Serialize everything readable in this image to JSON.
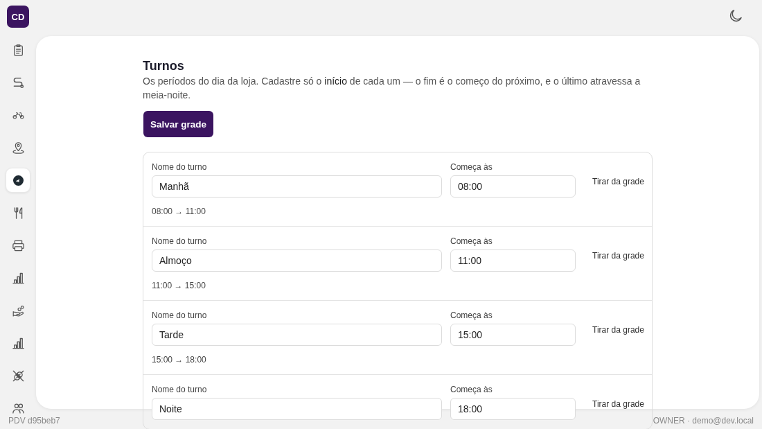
{
  "brand": {
    "initials": "CD"
  },
  "sidebar": {
    "items": [
      {
        "selected": false
      },
      {
        "selected": false
      },
      {
        "selected": false
      },
      {
        "selected": false
      },
      {
        "selected": true
      },
      {
        "selected": false
      },
      {
        "selected": false
      },
      {
        "selected": false
      },
      {
        "selected": false
      },
      {
        "selected": false
      },
      {
        "selected": false
      },
      {
        "selected": false
      }
    ]
  },
  "page": {
    "title": "Turnos",
    "description": "Os períodos do dia da loja. Cadastre só o **início** de cada um — o fim é o começo do próximo, e o último atravessa a meia-noite.",
    "save_button": "Salvar grade"
  },
  "shifts": [
    {
      "name_label": "Nome do turno",
      "name": "Manhã",
      "start_label": "Começa às",
      "start": "08:00",
      "remove_button": "Tirar da grade",
      "range": "08:00 → 11:00"
    },
    {
      "name_label": "Nome do turno",
      "name": "Almoço",
      "start_label": "Começa às",
      "start": "11:00",
      "remove_button": "Tirar da grade",
      "range": "11:00 → 15:00"
    },
    {
      "name_label": "Nome do turno",
      "name": "Tarde",
      "start_label": "Começa às",
      "start": "15:00",
      "remove_button": "Tirar da grade",
      "range": "15:00 → 18:00"
    },
    {
      "name_label": "Nome do turno",
      "name": "Noite",
      "start_label": "Começa às",
      "start": "18:00",
      "remove_button": "Tirar da grade"
    }
  ],
  "footer": {
    "build": "PDV d95beb7",
    "user": "OWNER · demo@dev.local"
  }
}
